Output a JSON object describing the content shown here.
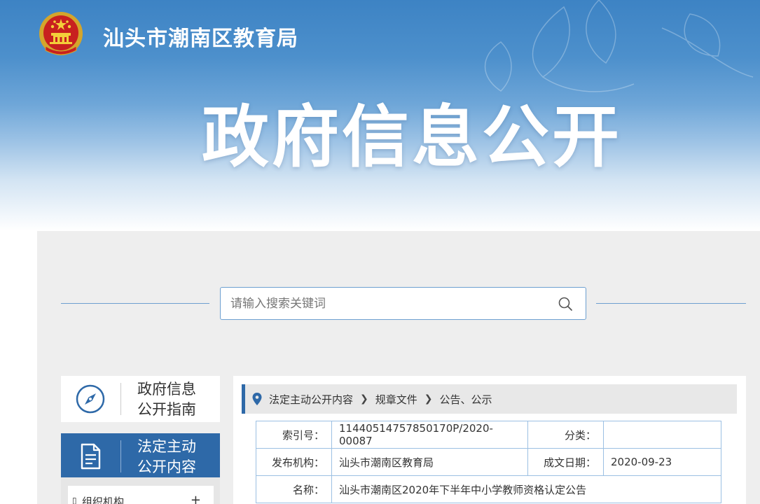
{
  "header": {
    "site_name": "汕头市潮南区教育局",
    "hero_title": "政府信息公开"
  },
  "search": {
    "placeholder": "请输入搜索关键词"
  },
  "nav": {
    "guide_line1": "政府信息",
    "guide_line2": "公开指南",
    "legal_line1": "法定主动",
    "legal_line2": "公开内容",
    "sub_item": "组织机构",
    "sub_toggle": "+"
  },
  "breadcrumb": [
    "法定主动公开内容",
    "规章文件",
    "公告、公示"
  ],
  "meta": {
    "index_label": "索引号：",
    "index_value": "11440514757850170P/2020-00087",
    "category_label": "分类：",
    "category_value": "",
    "publisher_label": "发布机构：",
    "publisher_value": "汕头市潮南区教育局",
    "date_label": "成文日期：",
    "date_value": "2020-09-23",
    "name_label": "名称：",
    "name_value": "汕头市潮南区2020年下半年中小学教师资格认定公告"
  },
  "colors": {
    "brand_blue": "#2e69a8",
    "line_blue": "#6d9fd0",
    "table_border": "#9cc0e3"
  }
}
